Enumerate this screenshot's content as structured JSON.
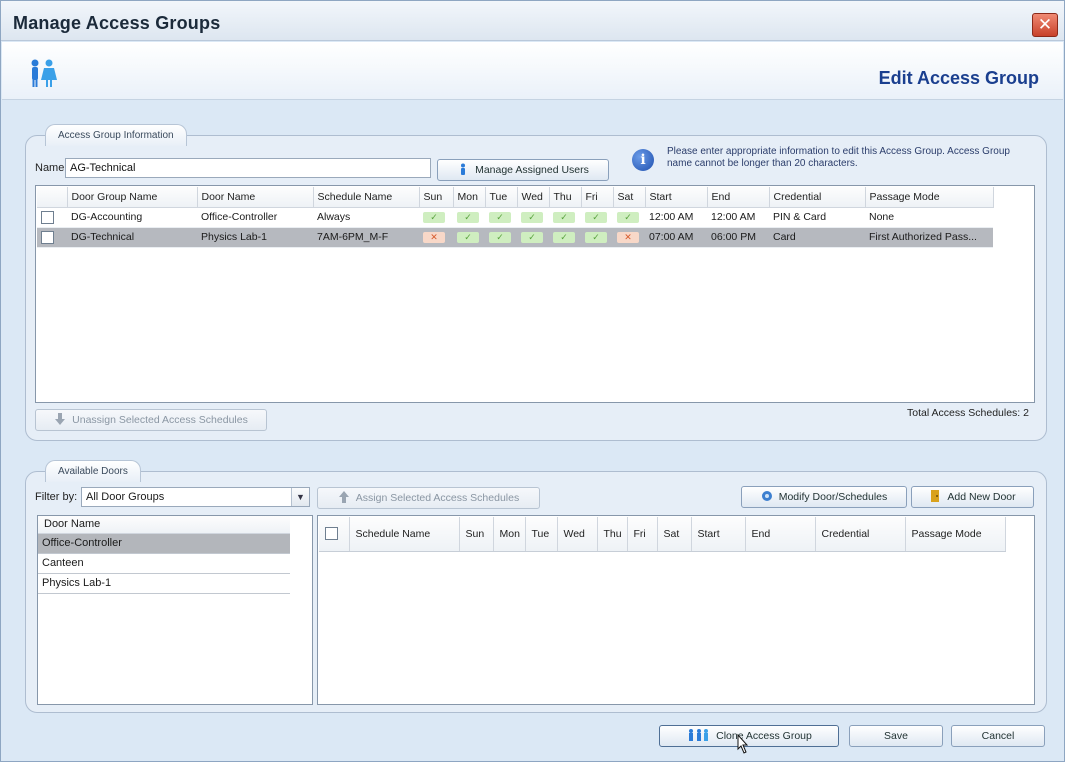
{
  "window": {
    "title": "Manage Access Groups",
    "close_glyph": "✕",
    "heading": "Edit Access Group",
    "header_icon": "people-icon"
  },
  "info_group": {
    "tab_label": "Access Group Information",
    "name_label": "Name",
    "name_value": "AG-Technical",
    "manage_users_label": "Manage Assigned Users",
    "info_glyph": "i",
    "info_text": "Please enter appropriate information to edit this Access Group. Access Group name cannot be longer than 20 characters.",
    "columns": [
      "Door Group Name",
      "Door Name",
      "Schedule Name",
      "Sun",
      "Mon",
      "Tue",
      "Wed",
      "Thu",
      "Fri",
      "Sat",
      "Start",
      "End",
      "Credential",
      "Passage Mode"
    ],
    "rows": [
      {
        "door_group": "DG-Accounting",
        "door": "Office-Controller",
        "schedule": "Always",
        "days": [
          true,
          true,
          true,
          true,
          true,
          true,
          true
        ],
        "start": "12:00 AM",
        "end": "12:00 AM",
        "credential": "PIN & Card",
        "passage": "None",
        "selected": false
      },
      {
        "door_group": "DG-Technical",
        "door": "Physics Lab-1",
        "schedule": "7AM-6PM_M-F",
        "days": [
          false,
          true,
          true,
          true,
          true,
          true,
          false
        ],
        "start": "07:00 AM",
        "end": "06:00 PM",
        "credential": "Card",
        "passage": "First Authorized Pass...",
        "selected": true
      }
    ],
    "unassign_label": "Unassign Selected Access Schedules",
    "total_label": "Total Access Schedules: 2"
  },
  "doors_group": {
    "tab_label": "Available Doors",
    "filter_label": "Filter by:",
    "filter_value": "All Door Groups",
    "assign_label": "Assign Selected Access Schedules",
    "modify_label": "Modify Door/Schedules",
    "add_door_label": "Add New Door",
    "door_list_header": "Door Name",
    "doors": [
      "Office-Controller",
      "Canteen",
      "Physics Lab-1"
    ],
    "selected_door": 0,
    "avail_columns": [
      "Schedule Name",
      "Sun",
      "Mon",
      "Tue",
      "Wed",
      "Thu",
      "Fri",
      "Sat",
      "Start",
      "End",
      "Credential",
      "Passage Mode"
    ]
  },
  "footer": {
    "clone_label": "Clone Access Group",
    "save_label": "Save",
    "cancel_label": "Cancel"
  }
}
